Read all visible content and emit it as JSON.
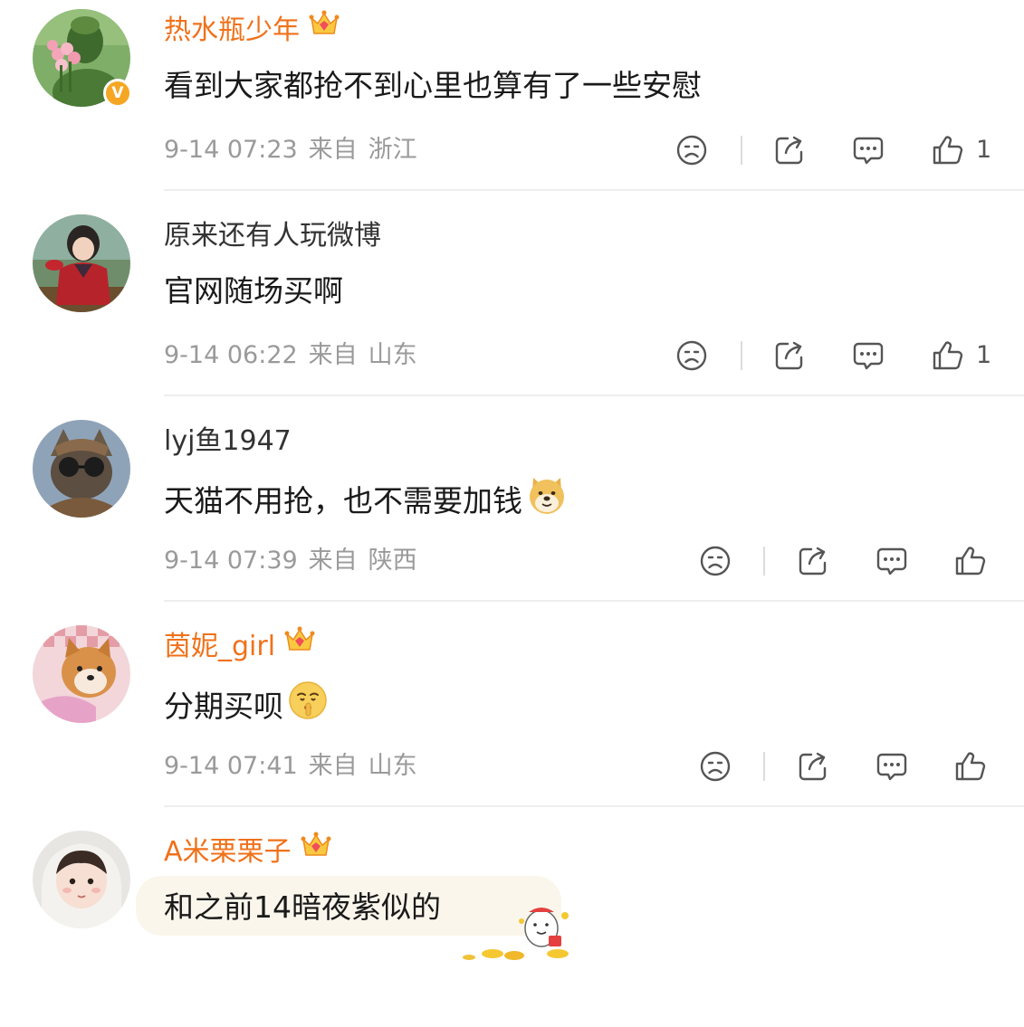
{
  "comments": [
    {
      "username": "热水瓶少年",
      "content": "看到大家都抢不到心里也算有了一些安慰",
      "date": "9-14 07:23",
      "from": "来自",
      "location": "浙江",
      "likes": "1",
      "vip": true,
      "verified": true,
      "verified_badge": "V"
    },
    {
      "username": "原来还有人玩微博",
      "content": "官网随场买啊",
      "date": "9-14 06:22",
      "from": "来自",
      "location": "山东",
      "likes": "1",
      "vip": false
    },
    {
      "username": "lyj鱼1947",
      "content": "天猫不用抢，也不需要加钱",
      "date": "9-14 07:39",
      "from": "来自",
      "location": "陕西",
      "likes": "",
      "vip": false,
      "emoji": "doge-emoji"
    },
    {
      "username": "茵妮_girl",
      "content": "分期买呗",
      "date": "9-14 07:41",
      "from": "来自",
      "location": "山东",
      "likes": "",
      "vip": true,
      "emoji": "shush-emoji"
    },
    {
      "username": "A米栗栗子",
      "content": "和之前14暗夜紫似的",
      "vip": true,
      "sticker": "lucky-bubble-sticker"
    }
  ],
  "icons": {
    "dislike": "dislike-face-icon",
    "repost": "repost-icon",
    "comment": "comment-icon",
    "like": "thumbs-up-icon",
    "vip": "vip-crown-icon"
  },
  "colors": {
    "vip_name": "#f0711a",
    "normal_name": "#333333",
    "meta": "#9a9a9a",
    "icon": "#555555",
    "verified_badge": "#f5a623"
  }
}
